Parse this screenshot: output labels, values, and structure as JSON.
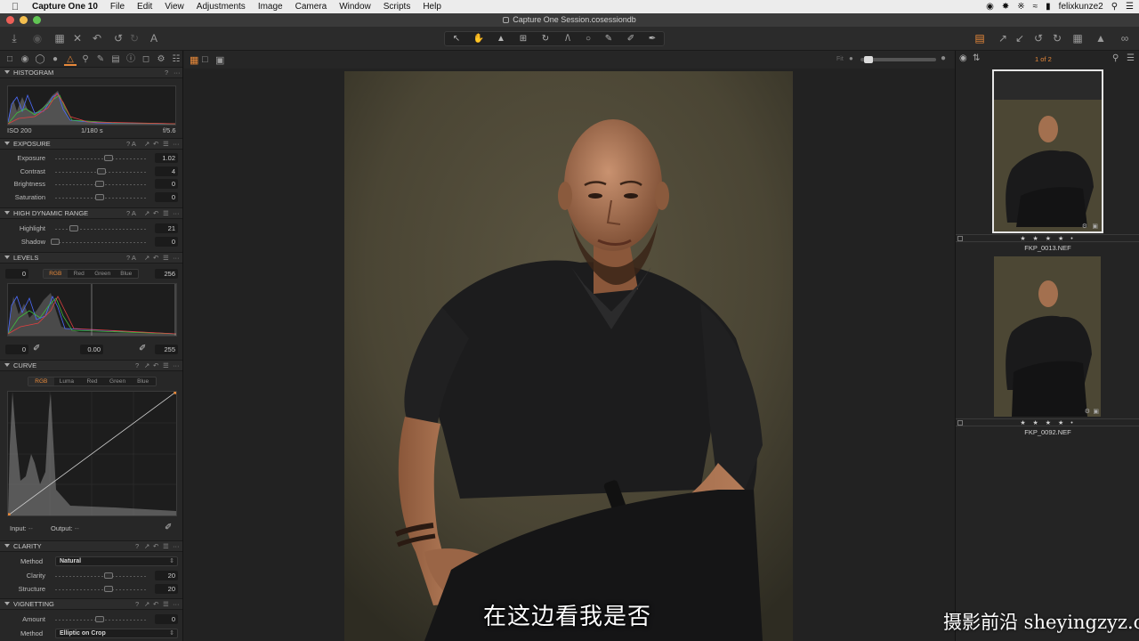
{
  "menubar": {
    "app_name": "Capture One 10",
    "items": [
      "File",
      "Edit",
      "View",
      "Adjustments",
      "Image",
      "Camera",
      "Window",
      "Scripts",
      "Help"
    ],
    "username": "felixkunze2"
  },
  "window": {
    "title": "Capture One Session.cosessiondb"
  },
  "left_panel": {
    "histogram": {
      "header": "HISTOGRAM",
      "iso": "ISO 200",
      "shutter": "1/180 s",
      "aperture": "f/5.6"
    },
    "exposure": {
      "header": "EXPOSURE",
      "rows": [
        {
          "label": "Exposure",
          "value": "1.02",
          "level": 0.6
        },
        {
          "label": "Contrast",
          "value": "4",
          "level": 0.52
        },
        {
          "label": "Brightness",
          "value": "0",
          "level": 0.5
        },
        {
          "label": "Saturation",
          "value": "0",
          "level": 0.5
        }
      ]
    },
    "hdr": {
      "header": "HIGH DYNAMIC RANGE",
      "rows": [
        {
          "label": "Highlight",
          "value": "21",
          "level": 0.21
        },
        {
          "label": "Shadow",
          "value": "0",
          "level": 0
        }
      ]
    },
    "levels": {
      "header": "LEVELS",
      "input_low": "0",
      "input_high": "256",
      "channels": [
        "RGB",
        "Red",
        "Green",
        "Blue"
      ],
      "active_channel": "RGB",
      "output_low": "0",
      "midpoint": "0.00",
      "output_high": "255"
    },
    "curve": {
      "header": "CURVE",
      "channels": [
        "RGB",
        "Luma",
        "Red",
        "Green",
        "Blue"
      ],
      "active_channel": "RGB",
      "input_label": "Input:",
      "input_value": "--",
      "output_label": "Output:",
      "output_value": "--"
    },
    "clarity": {
      "header": "CLARITY",
      "method_label": "Method",
      "method_value": "Natural",
      "rows": [
        {
          "label": "Clarity",
          "value": "20",
          "level": 0.6
        },
        {
          "label": "Structure",
          "value": "20",
          "level": 0.6
        }
      ]
    },
    "vignetting": {
      "header": "VIGNETTING",
      "rows": [
        {
          "label": "Amount",
          "value": "0",
          "level": 0.5
        }
      ],
      "method_label": "Method",
      "method_value": "Elliptic on Crop"
    }
  },
  "viewer": {
    "fit_label": "Fit",
    "subtitle": "在这边看我是否",
    "watermark": "摄影前沿 sheyingzyz.com"
  },
  "browser": {
    "page_indicator": "1 of 2",
    "thumbnails": [
      {
        "filename": "FKP_0013.NEF",
        "stars": "★ ★ ★ ★ •",
        "selected": true
      },
      {
        "filename": "FKP_0092.NEF",
        "stars": "★ ★ ★ ★ •",
        "selected": false
      }
    ]
  },
  "colors": {
    "accent": "#e8893a",
    "panel": "#272727",
    "viewer": "#222222",
    "backdrop": "#4e4834"
  }
}
